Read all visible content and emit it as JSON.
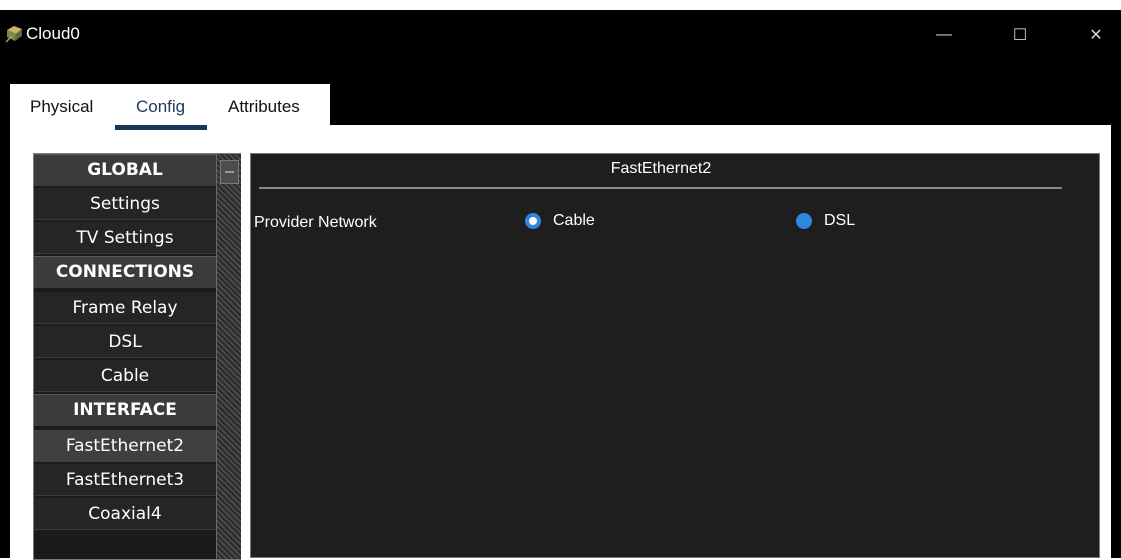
{
  "window": {
    "title": "Cloud0",
    "controls": {
      "minimize": "—",
      "maximize": "☐",
      "close": "✕"
    }
  },
  "tabs": [
    {
      "label": "Physical",
      "active": false
    },
    {
      "label": "Config",
      "active": true
    },
    {
      "label": "Attributes",
      "active": false
    }
  ],
  "sidebar": {
    "items": [
      {
        "label": "GLOBAL",
        "kind": "header"
      },
      {
        "label": "Settings",
        "kind": "item"
      },
      {
        "label": "TV Settings",
        "kind": "item"
      },
      {
        "label": "CONNECTIONS",
        "kind": "header"
      },
      {
        "label": "Frame Relay",
        "kind": "item"
      },
      {
        "label": "DSL",
        "kind": "item"
      },
      {
        "label": "Cable",
        "kind": "item"
      },
      {
        "label": "INTERFACE",
        "kind": "header"
      },
      {
        "label": "FastEthernet2",
        "kind": "item",
        "selected": true
      },
      {
        "label": "FastEthernet3",
        "kind": "item"
      },
      {
        "label": "Coaxial4",
        "kind": "item"
      }
    ]
  },
  "main": {
    "title": "FastEthernet2",
    "provider_label": "Provider Network",
    "options": [
      {
        "label": "Cable",
        "checked": true
      },
      {
        "label": "DSL",
        "checked": false
      }
    ]
  },
  "colors": {
    "accent": "#2f86e0",
    "tab_underline": "#16365c"
  }
}
